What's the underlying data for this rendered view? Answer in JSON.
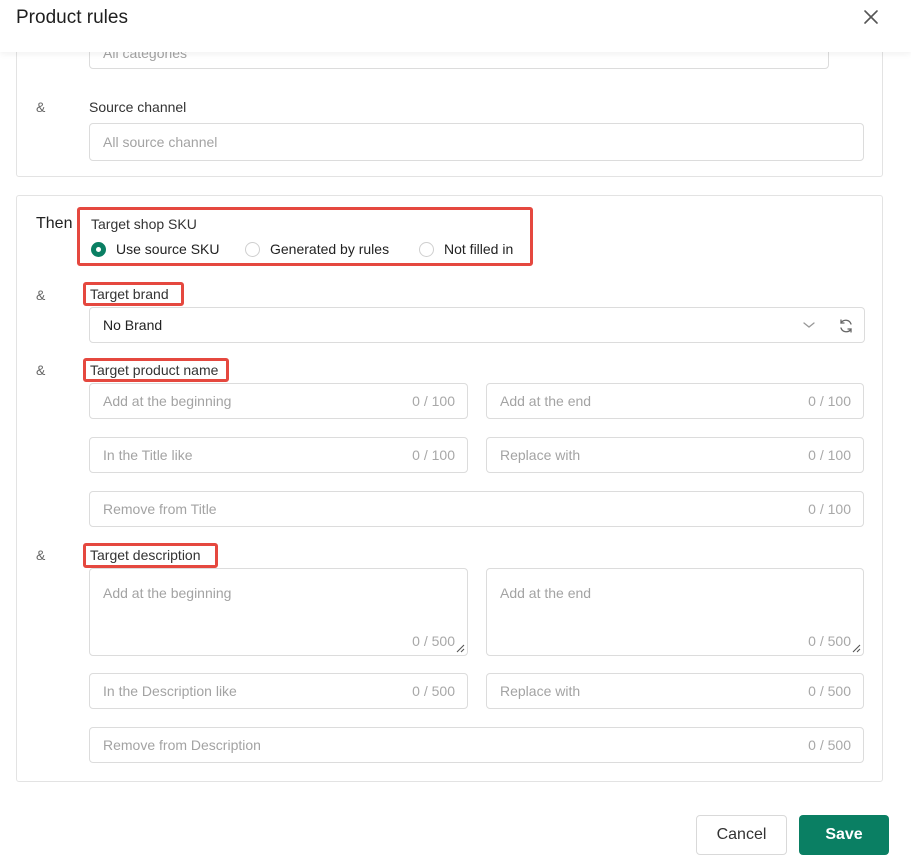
{
  "dialog": {
    "title": "Product rules"
  },
  "source_section": {
    "category_placeholder": "All categories",
    "amp": "&",
    "source_channel_label": "Source channel",
    "source_channel_placeholder": "All source channel"
  },
  "target_section": {
    "then_label": "Then",
    "amp": "&",
    "shop_sku": {
      "label": "Target shop SKU",
      "options": [
        "Use source SKU",
        "Generated by rules",
        "Not filled in"
      ],
      "selected": "Use source SKU"
    },
    "brand": {
      "label": "Target brand",
      "value": "No Brand"
    },
    "product_name": {
      "label": "Target product name",
      "add_beginning": "Add at the beginning",
      "add_end": "Add at the end",
      "title_like": "In the Title like",
      "replace_with": "Replace with",
      "remove_from": "Remove from Title",
      "count": "0 / 100"
    },
    "description": {
      "label": "Target description",
      "add_beginning": "Add at the beginning",
      "add_end": "Add at the end",
      "desc_like": "In the Description like",
      "replace_with": "Replace with",
      "remove_from": "Remove from Description",
      "count": "0 / 500"
    }
  },
  "footer": {
    "cancel_label": "Cancel",
    "save_label": "Save"
  },
  "colors": {
    "accent": "#0a7f63",
    "highlight": "#e5483f"
  },
  "icons": [
    "close-icon",
    "chevron-down-icon",
    "refresh-icon",
    "search-icon",
    "resize-handle-icon"
  ]
}
